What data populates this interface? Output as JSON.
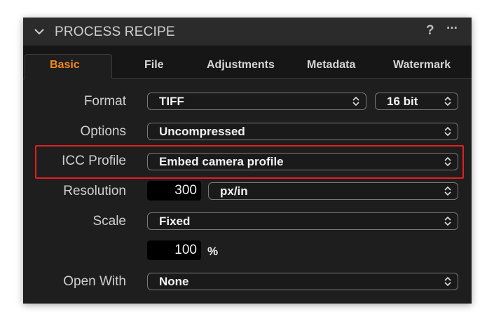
{
  "header": {
    "title": "PROCESS RECIPE",
    "help": "?",
    "more": "···"
  },
  "tabs": [
    {
      "label": "Basic",
      "active": true
    },
    {
      "label": "File",
      "active": false
    },
    {
      "label": "Adjustments",
      "active": false
    },
    {
      "label": "Metadata",
      "active": false
    },
    {
      "label": "Watermark",
      "active": false
    }
  ],
  "rows": {
    "format": {
      "label": "Format",
      "value": "TIFF",
      "bit_depth": "16 bit"
    },
    "options": {
      "label": "Options",
      "value": "Uncompressed"
    },
    "icc": {
      "label": "ICC Profile",
      "value": "Embed camera profile"
    },
    "resolution": {
      "label": "Resolution",
      "number": "300",
      "unit": "px/in"
    },
    "scale": {
      "label": "Scale",
      "value": "Fixed",
      "number": "100",
      "unit": "%"
    },
    "open_with": {
      "label": "Open With",
      "value": "None"
    }
  },
  "colors": {
    "accent": "#f28a1e",
    "highlight": "#e02020",
    "panel": "#1e1e1e"
  }
}
